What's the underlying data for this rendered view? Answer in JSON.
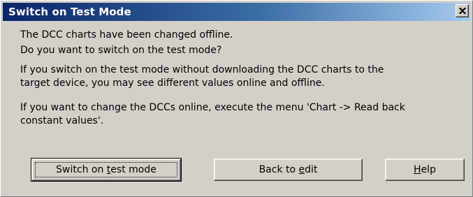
{
  "window": {
    "title": "Switch on Test Mode",
    "close_label": "X"
  },
  "messages": {
    "line1": "The DCC charts have been changed offline.",
    "line2": "Do you want to switch on the test mode?",
    "line3a": "If you switch on the test mode without downloading the DCC charts to the",
    "line3b": "target device, you may see different values online and offline.",
    "line4a": "If you want to change the DCCs online, execute the menu 'Chart -> Read back",
    "line4b": "constant values'."
  },
  "buttons": {
    "switch_pre": "Switch on ",
    "switch_accel": "t",
    "switch_post": "est mode",
    "back_pre": "Back to ",
    "back_accel": "e",
    "back_post": "dit",
    "help_accel": "H",
    "help_post": "elp"
  },
  "colors": {
    "face": "#d4d0c8",
    "title_start": "#0a246a",
    "title_end": "#a6caf0",
    "title_text": "#ffffff"
  },
  "icons": {
    "close": "close-icon"
  }
}
